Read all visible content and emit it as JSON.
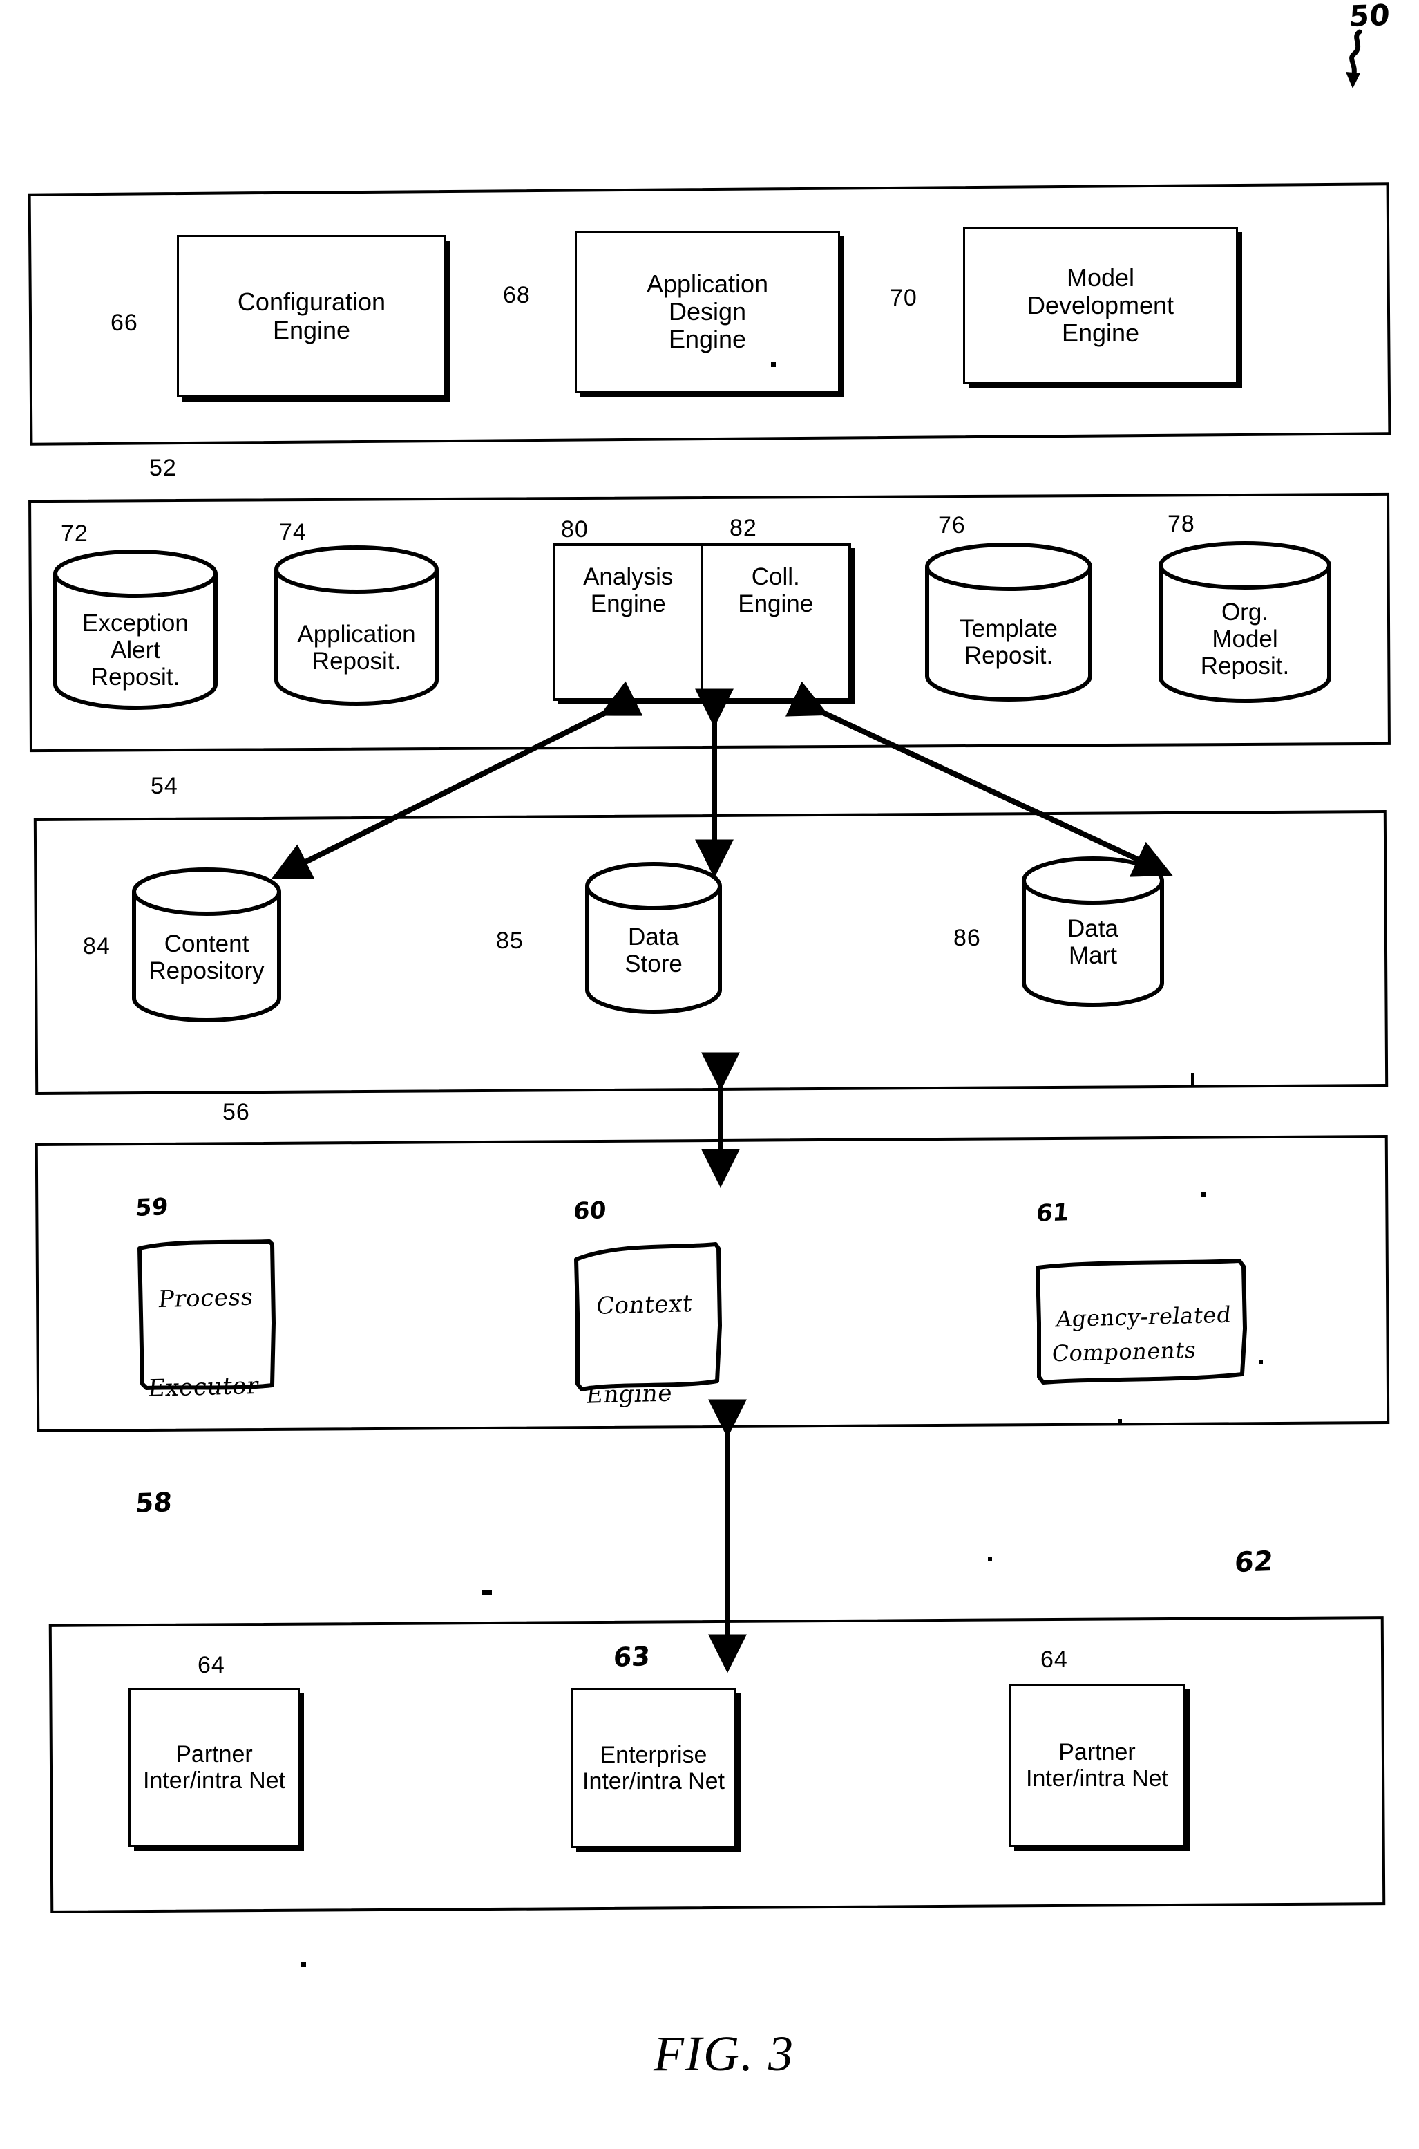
{
  "figure": {
    "caption": "FIG. 3",
    "system_reference": "50"
  },
  "tiers": [
    {
      "id": "tier-52",
      "reference": "52",
      "blocks": [
        {
          "reference": "66",
          "label": "Configuration\nEngine"
        },
        {
          "reference": "68",
          "label": "Application\nDesign\nEngine"
        },
        {
          "reference": "70",
          "label": "Model\nDevelopment\nEngine"
        }
      ]
    },
    {
      "id": "tier-54",
      "reference": "54",
      "cylinders_left": [
        {
          "reference": "72",
          "label": "Exception\nAlert\nReposit."
        },
        {
          "reference": "74",
          "label": "Application\nReposit."
        }
      ],
      "engine_box": {
        "left": {
          "reference": "80",
          "label": "Analysis\nEngine"
        },
        "right": {
          "reference": "82",
          "label": "Coll.\nEngine"
        }
      },
      "cylinders_right": [
        {
          "reference": "76",
          "label": "Template\nReposit."
        },
        {
          "reference": "78",
          "label": "Org.\nModel\nReposit."
        }
      ]
    },
    {
      "id": "tier-56",
      "reference": "56",
      "cylinders": [
        {
          "reference": "84",
          "label": "Content\nRepository"
        },
        {
          "reference": "85",
          "label": "Data\nStore"
        },
        {
          "reference": "86",
          "label": "Data\nMart"
        }
      ]
    },
    {
      "id": "tier-58",
      "reference": "58",
      "handwritten_blocks": [
        {
          "reference": "59",
          "label": "Process\n\nExecutor"
        },
        {
          "reference": "60",
          "label": "Context\n\nEngine"
        },
        {
          "reference": "61",
          "label": "Agency-related\nComponents"
        }
      ]
    },
    {
      "id": "tier-62",
      "reference": "62",
      "blocks": [
        {
          "reference": "64",
          "label": "Partner\nInter/intra Net"
        },
        {
          "reference": "63",
          "label": "Enterprise\nInter/intra Net"
        },
        {
          "reference": "64",
          "label": "Partner\nInter/intra Net"
        }
      ]
    }
  ],
  "colors": {
    "line": "#000000",
    "background": "#ffffff"
  }
}
